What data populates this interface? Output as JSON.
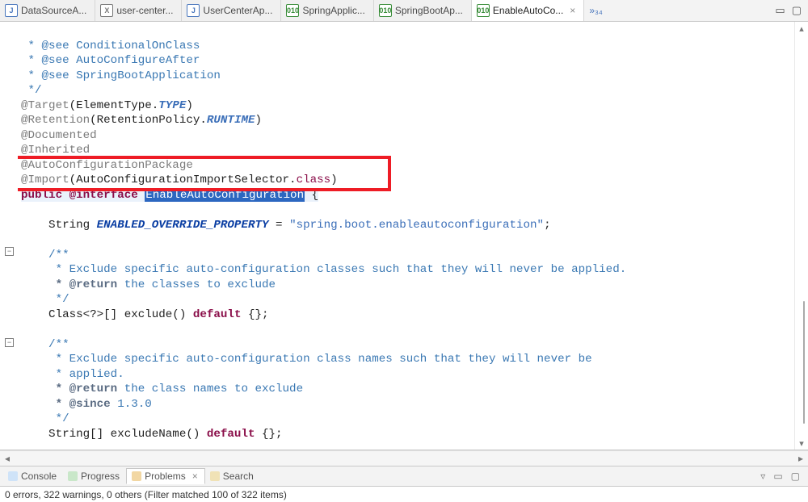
{
  "tabs": [
    {
      "label": "DataSourceA...",
      "icon": "j"
    },
    {
      "label": "user-center...",
      "icon": "x"
    },
    {
      "label": "UserCenterAp...",
      "icon": "j"
    },
    {
      "label": "SpringApplic...",
      "icon": "p"
    },
    {
      "label": "SpringBootAp...",
      "icon": "p"
    },
    {
      "label": "EnableAutoCo...",
      "icon": "p",
      "active": true,
      "closable": true
    }
  ],
  "overflow_label": "»₃₄",
  "code": {
    "c_see_cond": " * @see ConditionalOnClass",
    "c_see_after": " * @see AutoConfigureAfter",
    "c_see_sba": " * @see SpringBootApplication",
    "c_close": " */",
    "ann_target_pre": "@Target",
    "ann_target_arg_a": "(ElementType.",
    "ann_target_arg_b": "TYPE",
    "ann_target_arg_c": ")",
    "ann_ret_pre": "@Retention",
    "ann_ret_arg_a": "(RetentionPolicy.",
    "ann_ret_arg_b": "RUNTIME",
    "ann_ret_arg_c": ")",
    "ann_doc": "@Documented",
    "ann_inh": "@Inherited",
    "ann_acp": "@AutoConfigurationPackage",
    "ann_imp_pre": "@Import",
    "ann_imp_a": "(AutoConfigurationImportSelector.",
    "ann_imp_b": "class",
    "ann_imp_c": ")",
    "decl_pub": "public",
    "decl_int": "@interface",
    "decl_name": "EnableAutoConfiguration",
    "decl_brace": " {",
    "field_lead": "    String ",
    "field_name": "ENABLED_OVERRIDE_PROPERTY",
    "field_eq": " = ",
    "field_val": "\"spring.boot.enableautoconfiguration\"",
    "semi": ";",
    "jd_open": "    /**",
    "jd1_l1": "     * Exclude specific auto-configuration classes such that they will never be applied.",
    "jd1_ret": "     * @return",
    "jd1_ret_t": " the classes to exclude",
    "jd_close": "     */",
    "m1_a": "    Class<?>[] exclude() ",
    "m1_def": "default",
    "m1_b": " {};",
    "jd2_l1": "     * Exclude specific auto-configuration class names such that they will never be",
    "jd2_l2": "     * applied.",
    "jd2_ret": "     * @return",
    "jd2_ret_t": " the class names to exclude",
    "jd2_since": "     * @since",
    "jd2_since_t": " 1.3.0",
    "m2_a": "    String[] excludeName() ",
    "m2_b": " {};"
  },
  "bottom_tabs": {
    "console": "Console",
    "progress": "Progress",
    "problems": "Problems",
    "search": "Search"
  },
  "status_text": "0 errors, 322 warnings, 0 others (Filter matched 100 of 322 items)"
}
